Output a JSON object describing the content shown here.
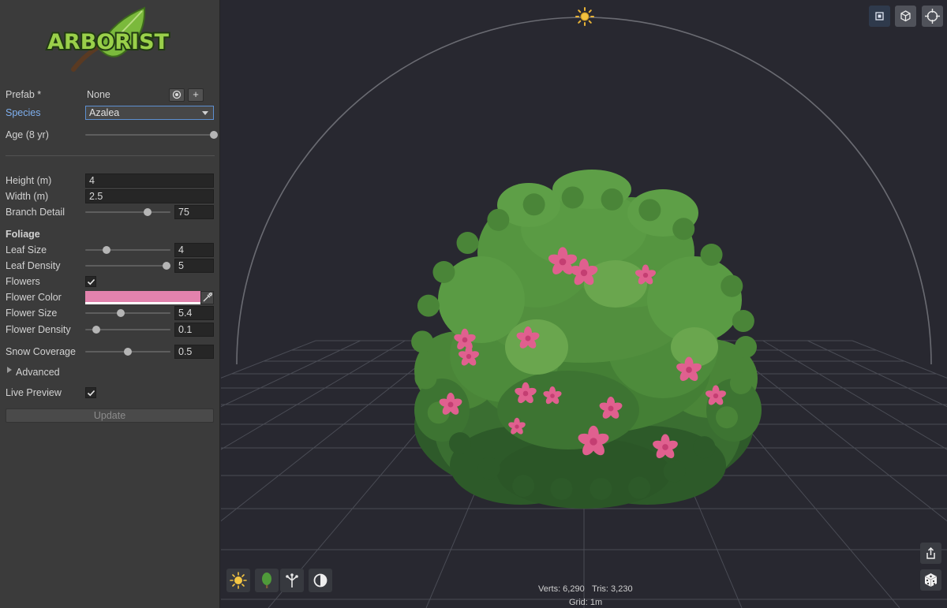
{
  "app": {
    "logo_text": "ARBORIST"
  },
  "sidebar": {
    "prefab": {
      "label": "Prefab *",
      "value": "None",
      "add_label": "+"
    },
    "species": {
      "label": "Species",
      "value": "Azalea"
    },
    "age": {
      "label": "Age (8 yr)",
      "level": 1.0
    },
    "height": {
      "label": "Height (m)",
      "value": "4"
    },
    "width": {
      "label": "Width (m)",
      "value": "2.5"
    },
    "branch_detail": {
      "label": "Branch Detail",
      "value": "75",
      "level": 0.73
    },
    "foliage_header": "Foliage",
    "leaf_size": {
      "label": "Leaf Size",
      "value": "4",
      "level": 0.25
    },
    "leaf_density": {
      "label": "Leaf Density",
      "value": "5",
      "level": 0.95
    },
    "flowers": {
      "label": "Flowers",
      "checked": true
    },
    "flower_color": {
      "label": "Flower Color",
      "color": "#e282ad"
    },
    "flower_size": {
      "label": "Flower Size",
      "value": "5.4",
      "level": 0.42
    },
    "flower_density": {
      "label": "Flower Density",
      "value": "0.1",
      "level": 0.13
    },
    "snow_coverage": {
      "label": "Snow Coverage",
      "value": "0.5",
      "level": 0.5
    },
    "advanced": {
      "label": "Advanced"
    },
    "live_preview": {
      "label": "Live Preview",
      "checked": true
    },
    "update": {
      "label": "Update"
    }
  },
  "viewport": {
    "top_buttons": [
      "frame-icon",
      "cube-icon",
      "crosshair-icon"
    ],
    "bottom_tools": [
      "sun-icon",
      "tree-icon",
      "branches-icon",
      "half-circle-icon"
    ],
    "right_tools": [
      "share-icon",
      "dice-icon"
    ],
    "stats": {
      "verts": "Verts: 6,290",
      "tris": "Tris: 3,230",
      "grid": "Grid: 1m"
    }
  },
  "colors": {
    "background": "#282830",
    "panel": "#3b3b3b",
    "accent": "#5d8fd0",
    "foliage": "#4f8a3c",
    "flower": "#e0608f"
  }
}
